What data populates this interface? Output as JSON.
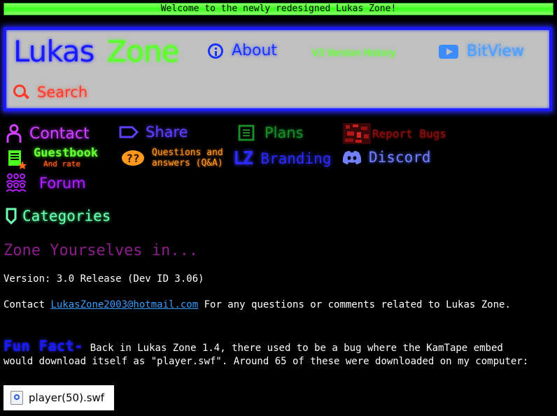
{
  "banner": {
    "text": "Welcome to the newly redesigned Lukas Zone!"
  },
  "logo": {
    "part1": "Lukas",
    "part2": "Zone"
  },
  "nav": {
    "about": "About",
    "version_history": "V3 Version History",
    "bitview": "BitView",
    "search": "Search"
  },
  "links": {
    "contact": "Contact",
    "share": "Share",
    "plans": "Plans",
    "report_bugs": "Report Bugs",
    "guestbook": "Guestbook",
    "guestbook_sub": "And rate",
    "qa_line1": "Questions and",
    "qa_line2": "answers (Q&A)",
    "branding_icon": "LZ",
    "branding": "Branding",
    "discord": "Discord",
    "forum": "Forum",
    "categories": "Categories"
  },
  "main": {
    "heading": "Zone Yourselves in...",
    "version": "Version: 3.0 Release (Dev ID 3.06)",
    "contact_prefix": "Contact ",
    "contact_email": "LukasZone2003@hotmail.com",
    "contact_suffix": " For any questions or comments related to Lukas Zone.",
    "funfact_title": "Fun Fact-",
    "funfact_text": "Back in Lukas Zone 1.4, there used to be a bug where the KamTape embed would download itself as \"player.swf\". Around 65 of these were downloaded on my computer:",
    "file_name": "player(50).swf"
  },
  "colors": {
    "background": "#000000",
    "banner": "#38ff1c",
    "nav_border": "#1a1aff",
    "nav_bg": "#c0c0c0"
  }
}
